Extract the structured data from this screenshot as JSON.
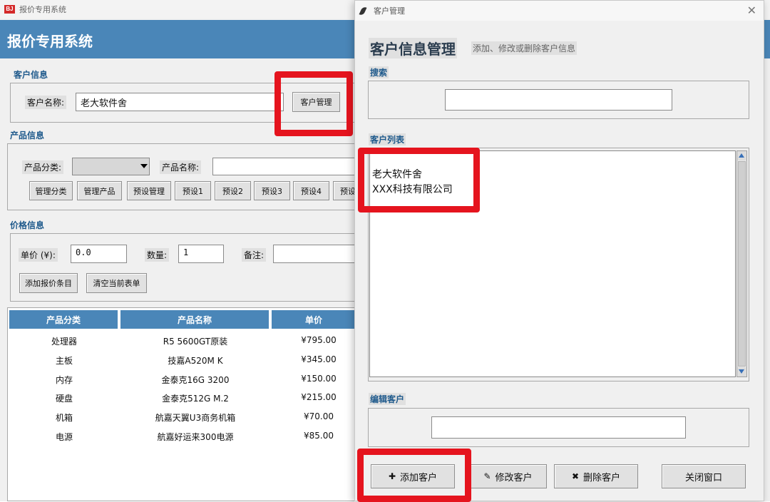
{
  "main": {
    "window_title": "报价专用系统",
    "logo_text": "BJ",
    "banner_title": "报价专用系统",
    "customer_section": {
      "title": "客户信息",
      "name_label": "客户名称:",
      "name_value": "老大软件舍",
      "manage_button": "客户管理"
    },
    "product_section": {
      "title": "产品信息",
      "category_label": "产品分类:",
      "category_value": "",
      "name_label": "产品名称:",
      "name_value": "",
      "buttons": [
        "管理分类",
        "管理产品",
        "预设管理",
        "预设1",
        "预设2",
        "预设3",
        "预设4",
        "预设"
      ]
    },
    "price_section": {
      "title": "价格信息",
      "unit_price_label": "单价 (¥):",
      "unit_price_value": "0.0",
      "quantity_label": "数量:",
      "quantity_value": "1",
      "note_label": "备注:",
      "note_value": "",
      "add_button": "添加报价条目",
      "clear_button": "清空当前表单"
    },
    "table": {
      "headers": [
        "产品分类",
        "产品名称",
        "单价"
      ],
      "rows": [
        [
          "处理器",
          "R5 5600GT原装",
          "¥795.00"
        ],
        [
          "主板",
          "技嘉A520M K",
          "¥345.00"
        ],
        [
          "内存",
          "金泰克16G 3200",
          "¥150.00"
        ],
        [
          "硬盘",
          "金泰克512G M.2",
          "¥215.00"
        ],
        [
          "机箱",
          "航嘉天翼U3商务机箱",
          "¥70.00"
        ],
        [
          "电源",
          "航嘉好运来300电源",
          "¥85.00"
        ]
      ]
    }
  },
  "dialog": {
    "title": "客户管理",
    "heading": "客户信息管理",
    "subtitle": "添加、修改或删除客户信息",
    "search_label": "搜索",
    "search_value": "",
    "list_label": "客户列表",
    "customers": [
      "老大软件舍",
      "XXX科技有限公司"
    ],
    "edit_label": "编辑客户",
    "edit_value": "",
    "buttons": {
      "add": "添加客户",
      "modify": "修改客户",
      "delete": "删除客户",
      "close": "关闭窗口"
    }
  },
  "colors": {
    "banner": "#4a86b8",
    "section_title": "#1f5a8c",
    "highlight": "#e5141e"
  }
}
